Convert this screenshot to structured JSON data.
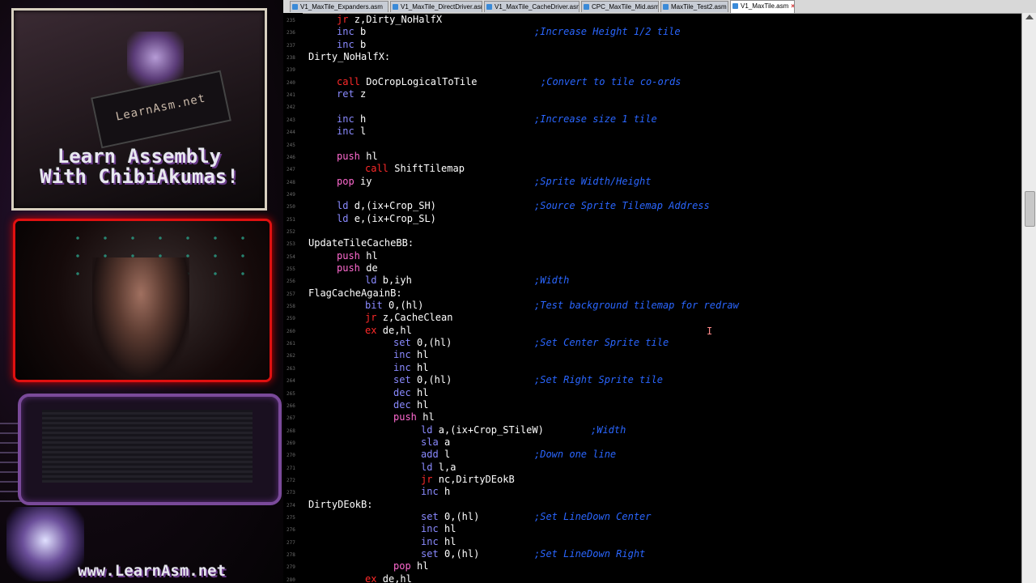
{
  "overlay": {
    "logo_text": "LearnAsm.net",
    "title_line1": "Learn Assembly",
    "title_line2": "With ChibiAkumas!",
    "footer_url": "www.LearnAsm.net"
  },
  "tabs": [
    {
      "label": "V1_MaxTile_Expanders.asm",
      "active": false
    },
    {
      "label": "V1_MaxTile_DirectDriver.asm",
      "active": false
    },
    {
      "label": "V1_MaxTile_CacheDriver.asm",
      "active": false
    },
    {
      "label": "CPC_MaxTile_Mid.asm",
      "active": false
    },
    {
      "label": "MaxTile_Test2.asm",
      "active": false
    },
    {
      "label": "V1_MaxTile.asm",
      "active": true
    }
  ],
  "lines": [
    {
      "n": "235",
      "label": "",
      "mn": "jr",
      "mc": "red",
      "ops": "z,Dirty_NoHalfX",
      "indent": 1,
      "cmt": ""
    },
    {
      "n": "236",
      "label": "",
      "mn": "inc",
      "mc": "blue",
      "ops": "b",
      "indent": 1,
      "cmt": ";Increase Height 1/2 tile"
    },
    {
      "n": "237",
      "label": "",
      "mn": "inc",
      "mc": "blue",
      "ops": "b",
      "indent": 1,
      "cmt": ""
    },
    {
      "n": "238",
      "label": "Dirty_NoHalfX:",
      "mn": "",
      "mc": "",
      "ops": "",
      "indent": 0,
      "cmt": ""
    },
    {
      "n": "239",
      "label": "",
      "mn": "",
      "mc": "",
      "ops": "",
      "indent": 0,
      "cmt": ""
    },
    {
      "n": "240",
      "label": "",
      "mn": "call",
      "mc": "red",
      "ops": "DoCropLogicalToTile",
      "indent": 1,
      "cmt": ";Convert to tile co-ords"
    },
    {
      "n": "241",
      "label": "",
      "mn": "ret",
      "mc": "blue",
      "ops": "z",
      "indent": 1,
      "cmt": ""
    },
    {
      "n": "242",
      "label": "",
      "mn": "",
      "mc": "",
      "ops": "",
      "indent": 0,
      "cmt": ""
    },
    {
      "n": "243",
      "label": "",
      "mn": "inc",
      "mc": "blue",
      "ops": "h",
      "indent": 1,
      "cmt": ";Increase size 1 tile"
    },
    {
      "n": "244",
      "label": "",
      "mn": "inc",
      "mc": "blue",
      "ops": "l",
      "indent": 1,
      "cmt": ""
    },
    {
      "n": "245",
      "label": "",
      "mn": "",
      "mc": "",
      "ops": "",
      "indent": 0,
      "cmt": ""
    },
    {
      "n": "246",
      "label": "",
      "mn": "push",
      "mc": "pink",
      "ops": "hl",
      "indent": 1,
      "cmt": ""
    },
    {
      "n": "247",
      "label": "",
      "mn": "call",
      "mc": "red",
      "ops": "ShiftTilemap",
      "indent": 2,
      "cmt": ""
    },
    {
      "n": "248",
      "label": "",
      "mn": "pop",
      "mc": "pink",
      "ops": "iy",
      "indent": 1,
      "cmt": ";Sprite Width/Height"
    },
    {
      "n": "249",
      "label": "",
      "mn": "",
      "mc": "",
      "ops": "",
      "indent": 0,
      "cmt": ""
    },
    {
      "n": "250",
      "label": "",
      "mn": "ld",
      "mc": "blue",
      "ops": "d,(ix+Crop_SH)",
      "indent": 1,
      "cmt": ";Source Sprite Tilemap Address"
    },
    {
      "n": "251",
      "label": "",
      "mn": "ld",
      "mc": "blue",
      "ops": "e,(ix+Crop_SL)",
      "indent": 1,
      "cmt": ""
    },
    {
      "n": "252",
      "label": "",
      "mn": "",
      "mc": "",
      "ops": "",
      "indent": 0,
      "cmt": ""
    },
    {
      "n": "253",
      "label": "UpdateTileCacheBB:",
      "mn": "",
      "mc": "",
      "ops": "",
      "indent": 0,
      "cmt": ""
    },
    {
      "n": "254",
      "label": "",
      "mn": "push",
      "mc": "pink",
      "ops": "hl",
      "indent": 1,
      "cmt": ""
    },
    {
      "n": "255",
      "label": "",
      "mn": "push",
      "mc": "pink",
      "ops": "de",
      "indent": 1,
      "cmt": ""
    },
    {
      "n": "256",
      "label": "",
      "mn": "ld",
      "mc": "blue",
      "ops": "b,iyh",
      "indent": 2,
      "cmt": ";Width"
    },
    {
      "n": "257",
      "label": "FlagCacheAgainB:",
      "mn": "",
      "mc": "",
      "ops": "",
      "indent": 0,
      "cmt": ""
    },
    {
      "n": "258",
      "label": "",
      "mn": "bit",
      "mc": "blue",
      "ops": "0,(hl)",
      "indent": 2,
      "cmt": ";Test background tilemap for redraw"
    },
    {
      "n": "259",
      "label": "",
      "mn": "jr",
      "mc": "red",
      "ops": "z,CacheClean",
      "indent": 2,
      "cmt": ""
    },
    {
      "n": "260",
      "label": "",
      "mn": "ex",
      "mc": "red",
      "ops": "de,hl",
      "indent": 2,
      "cmt": ""
    },
    {
      "n": "261",
      "label": "",
      "mn": "set",
      "mc": "blue",
      "ops": "0,(hl)",
      "indent": 3,
      "cmt": ";Set Center Sprite tile"
    },
    {
      "n": "262",
      "label": "",
      "mn": "inc",
      "mc": "blue",
      "ops": "hl",
      "indent": 3,
      "cmt": ""
    },
    {
      "n": "263",
      "label": "",
      "mn": "inc",
      "mc": "blue",
      "ops": "hl",
      "indent": 3,
      "cmt": ""
    },
    {
      "n": "264",
      "label": "",
      "mn": "set",
      "mc": "blue",
      "ops": "0,(hl)",
      "indent": 3,
      "cmt": ";Set Right Sprite tile"
    },
    {
      "n": "265",
      "label": "",
      "mn": "dec",
      "mc": "blue",
      "ops": "hl",
      "indent": 3,
      "cmt": ""
    },
    {
      "n": "266",
      "label": "",
      "mn": "dec",
      "mc": "blue",
      "ops": "hl",
      "indent": 3,
      "cmt": ""
    },
    {
      "n": "267",
      "label": "",
      "mn": "push",
      "mc": "pink",
      "ops": "hl",
      "indent": 3,
      "cmt": ""
    },
    {
      "n": "268",
      "label": "",
      "mn": "ld",
      "mc": "blue",
      "ops": "a,(ix+Crop_STileW)",
      "indent": 4,
      "cmt": ";Width"
    },
    {
      "n": "269",
      "label": "",
      "mn": "sla",
      "mc": "blue",
      "ops": "a",
      "indent": 4,
      "cmt": ""
    },
    {
      "n": "270",
      "label": "",
      "mn": "add",
      "mc": "blue",
      "ops": "l",
      "indent": 4,
      "cmt": ";Down one line"
    },
    {
      "n": "271",
      "label": "",
      "mn": "ld",
      "mc": "blue",
      "ops": "l,a",
      "indent": 4,
      "cmt": ""
    },
    {
      "n": "272",
      "label": "",
      "mn": "jr",
      "mc": "red",
      "ops": "nc,DirtyDEokB",
      "indent": 4,
      "cmt": ""
    },
    {
      "n": "273",
      "label": "",
      "mn": "inc",
      "mc": "blue",
      "ops": "h",
      "indent": 4,
      "cmt": ""
    },
    {
      "n": "274",
      "label": "DirtyDEokB:",
      "mn": "",
      "mc": "",
      "ops": "",
      "indent": 0,
      "cmt": ""
    },
    {
      "n": "275",
      "label": "",
      "mn": "set",
      "mc": "blue",
      "ops": "0,(hl)",
      "indent": 4,
      "cmt": ";Set LineDown Center"
    },
    {
      "n": "276",
      "label": "",
      "mn": "inc",
      "mc": "blue",
      "ops": "hl",
      "indent": 4,
      "cmt": ""
    },
    {
      "n": "277",
      "label": "",
      "mn": "inc",
      "mc": "blue",
      "ops": "hl",
      "indent": 4,
      "cmt": ""
    },
    {
      "n": "278",
      "label": "",
      "mn": "set",
      "mc": "blue",
      "ops": "0,(hl)",
      "indent": 4,
      "cmt": ";Set LineDown Right"
    },
    {
      "n": "279",
      "label": "",
      "mn": "pop",
      "mc": "pink",
      "ops": "hl",
      "indent": 3,
      "cmt": ""
    },
    {
      "n": "280",
      "label": "",
      "mn": "ex",
      "mc": "red",
      "ops": "de,hl",
      "indent": 2,
      "cmt": ""
    }
  ],
  "colors": {
    "comment": "#2a66ff",
    "mnemonic_blue": "#8a8aff",
    "mnemonic_red": "#ff2a2a",
    "mnemonic_pink": "#ff6ad0",
    "webcam_border": "#e01010",
    "overlay_purple": "#7a4a9a"
  },
  "icons": [
    "asm-file-icon",
    "tab-close-icon",
    "scroll-up-arrow-icon"
  ]
}
